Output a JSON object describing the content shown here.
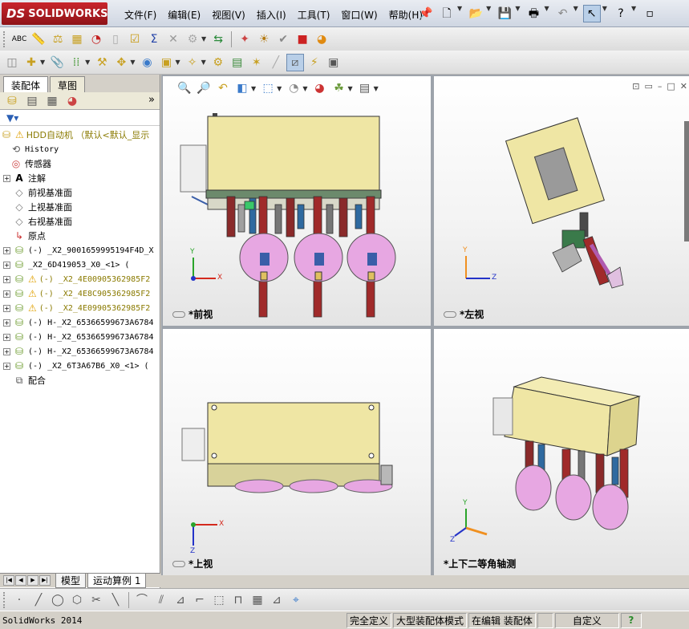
{
  "app": {
    "brand_ds": "DS",
    "brand_name": "SOLIDWORKS"
  },
  "menu": [
    "文件(F)",
    "编辑(E)",
    "视图(V)",
    "插入(I)",
    "工具(T)",
    "窗口(W)",
    "帮助(H)"
  ],
  "quick_icons": [
    "pin-icon",
    "new-doc-icon",
    "open-icon",
    "save-icon",
    "print-icon",
    "undo-icon",
    "select-icon",
    "help-icon"
  ],
  "panel_tabs": {
    "assembly": "装配体",
    "sketch": "草图"
  },
  "tree": {
    "root": "HDD自动机 （默认<默认_显示",
    "history": "History",
    "sensors": "传感器",
    "annotations": "注解",
    "front_plane": "前视基准面",
    "top_plane": "上视基准面",
    "right_plane": "右视基准面",
    "origin": "原点",
    "components": [
      {
        "label": "(-) _X2_9001659995194F4D_X",
        "warn": false,
        "yellow": false
      },
      {
        "label": "_X2_6D419053_X0_<1> (",
        "warn": false,
        "yellow": false
      },
      {
        "label": "(-) _X2_4E00905362985F2",
        "warn": true,
        "yellow": true
      },
      {
        "label": "(-) _X2_4E8C905362985F2",
        "warn": true,
        "yellow": true
      },
      {
        "label": "(-) _X2_4E09905362985F2",
        "warn": true,
        "yellow": true
      },
      {
        "label": "(-) H-_X2_65366599673A6784",
        "warn": false,
        "yellow": false
      },
      {
        "label": "(-) H-_X2_65366599673A6784",
        "warn": false,
        "yellow": false
      },
      {
        "label": "(-) H-_X2_65366599673A6784",
        "warn": false,
        "yellow": false
      },
      {
        "label": "(-) _X2_6T3A67B6_X0_<1> (",
        "warn": false,
        "yellow": false
      }
    ],
    "mates": "配合"
  },
  "bottom_tabs": {
    "model": "模型",
    "motion": "运动算例 1"
  },
  "viewports": {
    "front": "*前视",
    "left": "*左视",
    "top": "*上视",
    "iso": "*上下二等角轴测"
  },
  "axes": {
    "x": "X",
    "y": "Y",
    "z": "Z"
  },
  "statusbar": {
    "app_version": "SolidWorks 2014",
    "definition": "完全定义",
    "mode": "大型装配体模式",
    "editing": "在编辑 装配体",
    "custom": "自定义",
    "help": "?"
  },
  "colors": {
    "housing": "#efe6a4",
    "disc": "#e7a7e2",
    "accent_blue": "#3a5ea8",
    "axis_x": "#d42a1e",
    "axis_y": "#2aa42a",
    "axis_z": "#2433c8"
  }
}
